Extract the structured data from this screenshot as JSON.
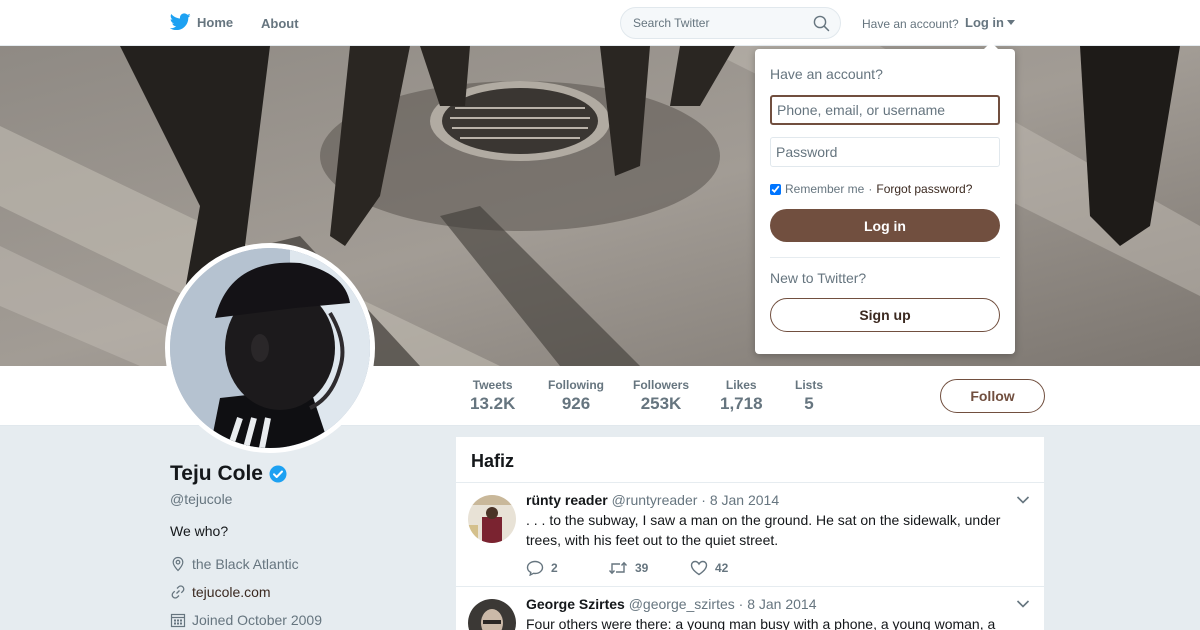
{
  "nav": {
    "home_label": "Home",
    "about_label": "About",
    "search_placeholder": "Search Twitter",
    "have_account_text": "Have an account?",
    "login_label": "Log in"
  },
  "profile": {
    "name": "Teju Cole",
    "handle": "@tejucole",
    "bio": "We who?",
    "location": "the Black Atlantic",
    "website": "tejucole.com",
    "joined": "Joined October 2009",
    "verified": true
  },
  "stats": [
    {
      "label": "Tweets",
      "value": "13.2K"
    },
    {
      "label": "Following",
      "value": "926"
    },
    {
      "label": "Followers",
      "value": "253K"
    },
    {
      "label": "Likes",
      "value": "1,718"
    },
    {
      "label": "Lists",
      "value": "5"
    }
  ],
  "follow_label": "Follow",
  "timeline": {
    "title": "Hafiz",
    "tweets": [
      {
        "name": "rünty reader",
        "handle": "@runtyreader",
        "date": "· 8 Jan 2014",
        "text": ". . . to the subway, I saw a man on the ground. He sat on the sidewalk, under trees, with his feet out to the quiet street.",
        "replies": "2",
        "retweets": "39",
        "likes": "42"
      },
      {
        "name": "George Szirtes",
        "handle": "@george_szirtes",
        "date": "· 8 Jan 2014",
        "text": "Four others were there: a young man busy with a phone, a young woman, a"
      }
    ]
  },
  "login_dropdown": {
    "title": "Have an account?",
    "username_placeholder": "Phone, email, or username",
    "password_placeholder": "Password",
    "remember_label": "Remember me",
    "separator": "·",
    "forgot_label": "Forgot password?",
    "login_button": "Log in",
    "new_text": "New to Twitter?",
    "signup_button": "Sign up",
    "remember_checked": true
  },
  "colors": {
    "accent": "#714f3f",
    "link": "#3b2920",
    "twitter_blue": "#1da1f2",
    "background": "#e6ecf0"
  }
}
